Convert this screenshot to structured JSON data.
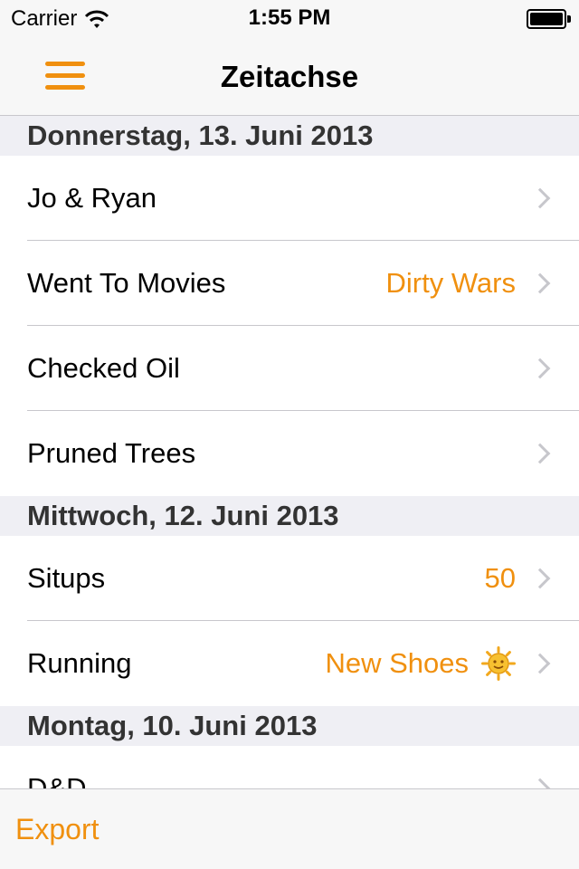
{
  "status_bar": {
    "carrier": "Carrier",
    "time": "1:55 PM",
    "wifi_icon": "wifi-icon",
    "battery_icon": "battery-icon"
  },
  "nav": {
    "title": "Zeitachse",
    "menu_icon": "hamburger-menu-icon"
  },
  "sections": [
    {
      "header": "Donnerstag, 13. Juni 2013",
      "rows": [
        {
          "title": "Jo & Ryan",
          "detail": ""
        },
        {
          "title": "Went To Movies",
          "detail": "Dirty Wars"
        },
        {
          "title": "Checked Oil",
          "detail": ""
        },
        {
          "title": "Pruned Trees",
          "detail": ""
        }
      ]
    },
    {
      "header": "Mittwoch, 12. Juni 2013",
      "rows": [
        {
          "title": "Situps",
          "detail": "50"
        },
        {
          "title": "Running",
          "detail": "New Shoes",
          "icon": "sun-emoji-icon"
        }
      ]
    },
    {
      "header": "Montag, 10. Juni 2013",
      "rows": [
        {
          "title": "D&D",
          "detail": ""
        }
      ]
    }
  ],
  "toolbar": {
    "export_label": "Export"
  },
  "colors": {
    "accent": "#f0900f",
    "separator": "#c8c7cc",
    "section_bg": "#efeff4",
    "bar_bg": "#f7f7f7"
  }
}
